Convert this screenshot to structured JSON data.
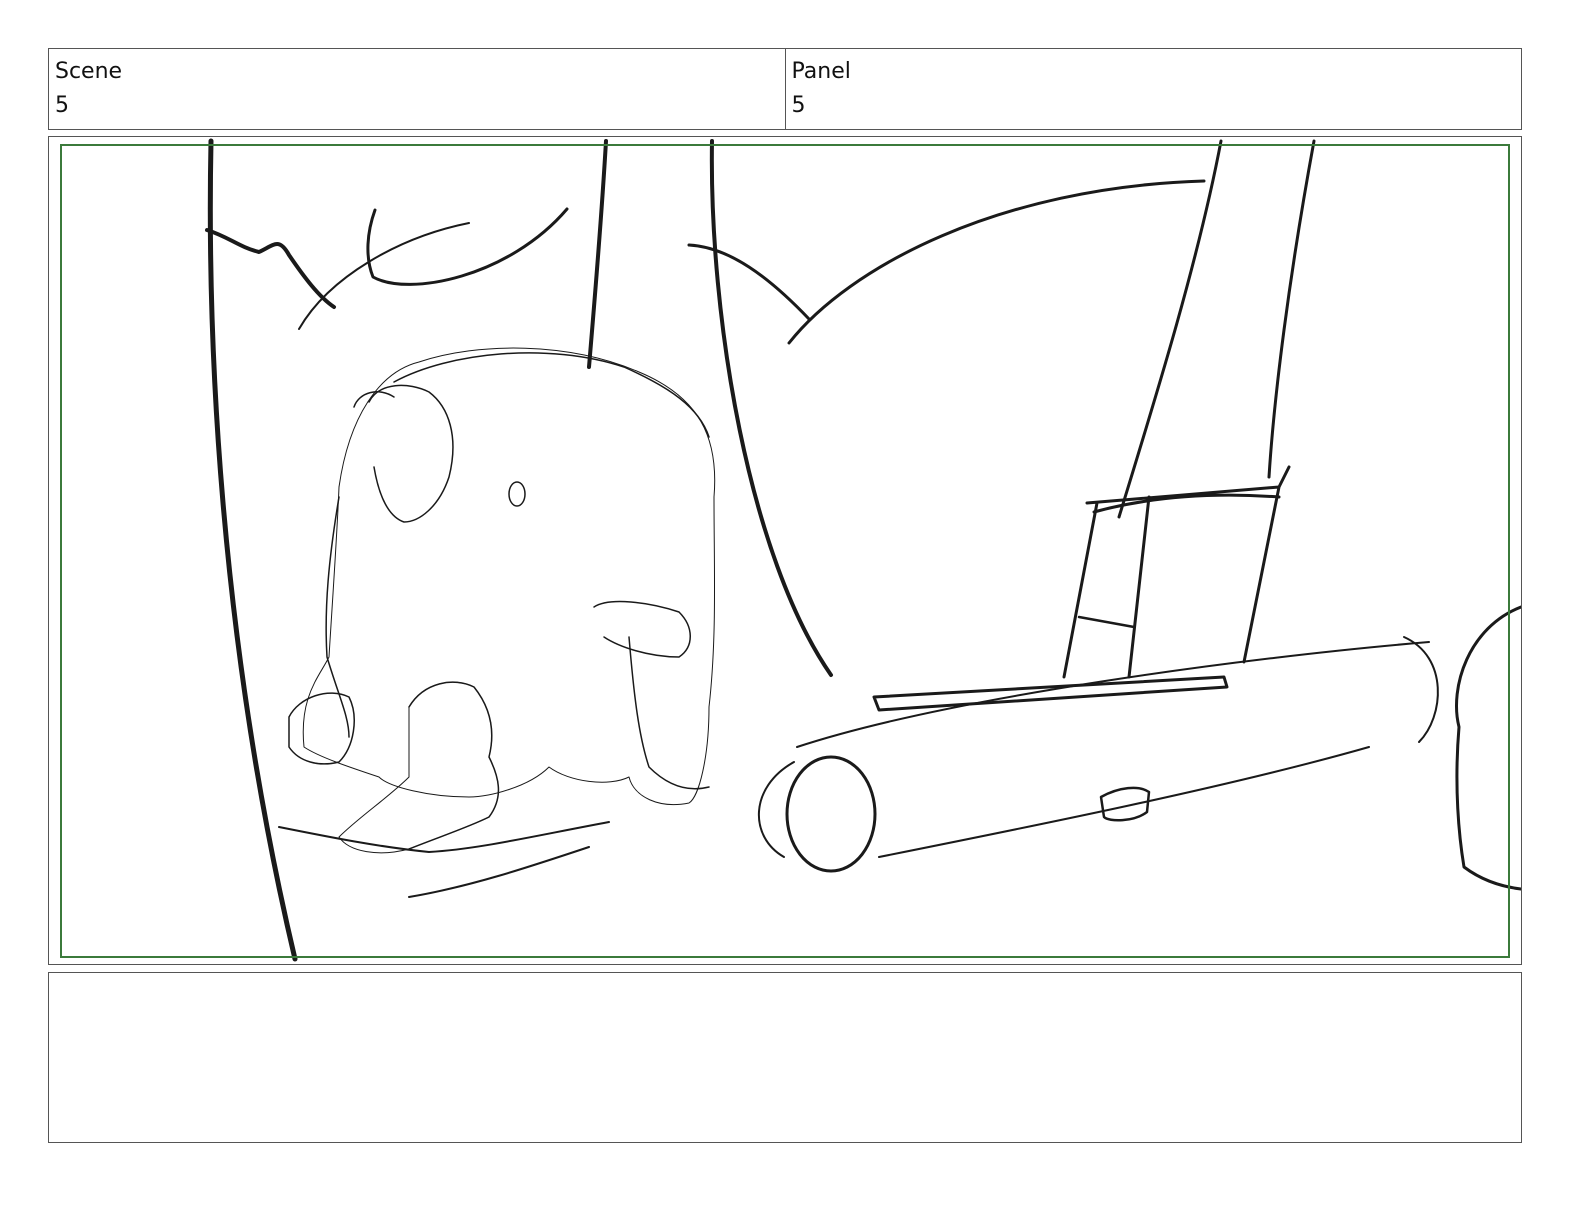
{
  "header": {
    "scene_label": "Scene",
    "scene_value": "5",
    "panel_label": "Panel",
    "panel_value": "5"
  },
  "notes": {
    "text": ""
  },
  "colors": {
    "border": "#555555",
    "safe_frame": "#3b7a3b",
    "ink": "#1a1a1a",
    "tone_light": "#e3e3e3",
    "tone_dark": "#a8a8a8"
  }
}
